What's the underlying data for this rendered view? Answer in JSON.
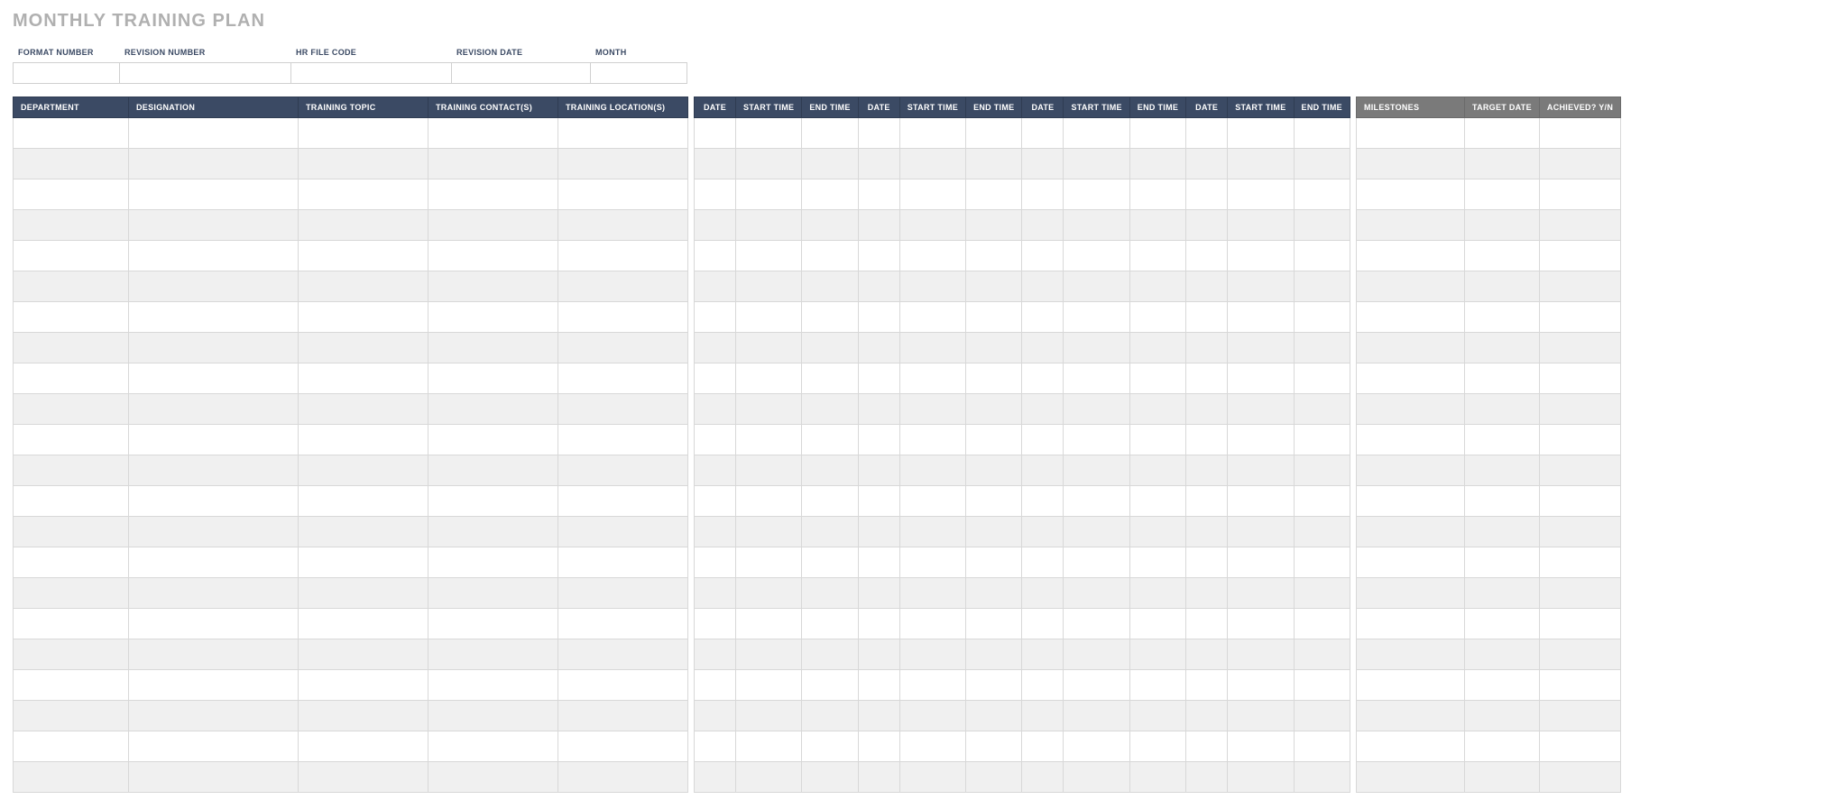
{
  "title": "MONTHLY TRAINING PLAN",
  "meta": {
    "labels": {
      "format_number": "FORMAT NUMBER",
      "revision_number": "REVISION NUMBER",
      "hr_file_code": "HR FILE CODE",
      "revision_date": "REVISION DATE",
      "month": "MONTH"
    },
    "values": {
      "format_number": "",
      "revision_number": "",
      "hr_file_code": "",
      "revision_date": "",
      "month": ""
    }
  },
  "columns": {
    "main": {
      "department": "DEPARTMENT",
      "designation": "DESIGNATION",
      "training_topic": "TRAINING TOPIC",
      "training_contacts": "TRAINING CONTACT(S)",
      "training_locations": "TRAINING LOCATION(S)"
    },
    "schedule": {
      "date": "DATE",
      "start_time": "START TIME",
      "end_time": "END TIME"
    },
    "milestones": {
      "milestones": "MILESTONES",
      "target_date": "TARGET DATE",
      "achieved": "ACHIEVED? Y/N"
    }
  },
  "schedule_week_count": 4,
  "row_count": 22,
  "rows": []
}
